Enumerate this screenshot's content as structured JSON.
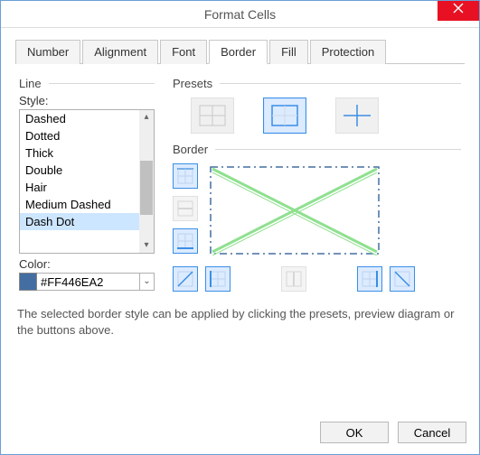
{
  "window": {
    "title": "Format Cells"
  },
  "tabs": {
    "number": "Number",
    "alignment": "Alignment",
    "font": "Font",
    "border": "Border",
    "fill": "Fill",
    "protection": "Protection"
  },
  "line": {
    "group": "Line",
    "style_label": "Style:",
    "items": {
      "dashed": "Dashed",
      "dotted": "Dotted",
      "thick": "Thick",
      "double": "Double",
      "hair": "Hair",
      "medium_dashed": "Medium Dashed",
      "dash_dot": "Dash Dot"
    },
    "color_label": "Color:",
    "color_value": "#FF446EA2"
  },
  "presets": {
    "group": "Presets"
  },
  "border": {
    "group": "Border"
  },
  "hint": "The selected border style can be applied by clicking the presets, preview diagram or the buttons above.",
  "buttons": {
    "ok": "OK",
    "cancel": "Cancel"
  },
  "icons": {
    "preset_none": "none-grid",
    "preset_outline": "outline-grid",
    "preset_inside": "inside-grid",
    "bb_top": "top-border",
    "bb_hmid": "horizontal-mid",
    "bb_bottom": "bottom-border",
    "bb_diag_up": "diagonal-up",
    "bb_left": "left-border",
    "bb_vmid": "vertical-mid",
    "bb_right": "right-border",
    "bb_diag_down": "diagonal-down"
  }
}
